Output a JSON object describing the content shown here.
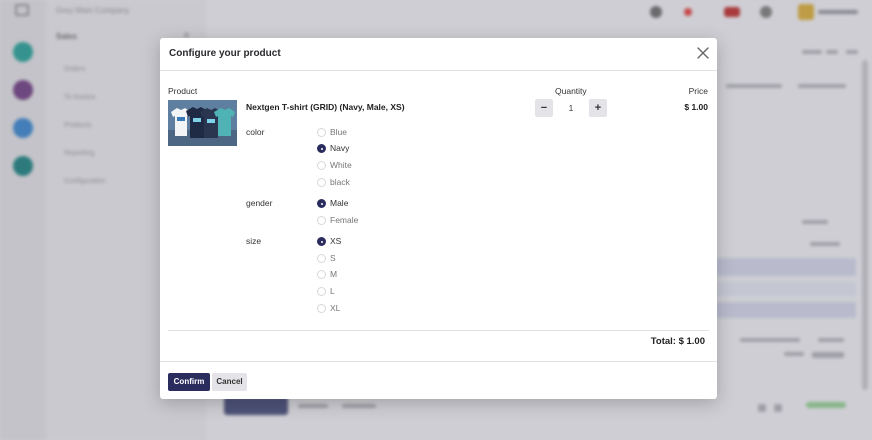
{
  "background": {
    "breadcrumb": "Grey Main Company",
    "app_title": "Sales",
    "menu": [
      "Orders",
      "To Invoice",
      "Products",
      "Reporting",
      "Configuration"
    ]
  },
  "modal": {
    "title": "Configure your product",
    "headers": {
      "product": "Product",
      "quantity": "Quantity",
      "price": "Price"
    },
    "product_name": "Nextgen T-shirt (GRID) (Navy, Male, XS)",
    "price": "$ 1.00",
    "quantity": "1",
    "qty_minus": "−",
    "qty_plus": "+",
    "attributes": {
      "color": {
        "label": "color",
        "options": [
          "Blue",
          "Navy",
          "White",
          "black"
        ],
        "selected": "Navy"
      },
      "gender": {
        "label": "gender",
        "options": [
          "Male",
          "Female"
        ],
        "selected": "Male"
      },
      "size": {
        "label": "size",
        "options": [
          "XS",
          "S",
          "M",
          "L",
          "XL"
        ],
        "selected": "XS"
      }
    },
    "total": "Total: $ 1.00",
    "confirm_label": "Confirm",
    "cancel_label": "Cancel"
  },
  "colors": {
    "accent": "#2b2c5e",
    "button_secondary": "#e4e4e8"
  },
  "icons": {
    "close": "close-icon",
    "product_image": "tshirt-product-image"
  }
}
